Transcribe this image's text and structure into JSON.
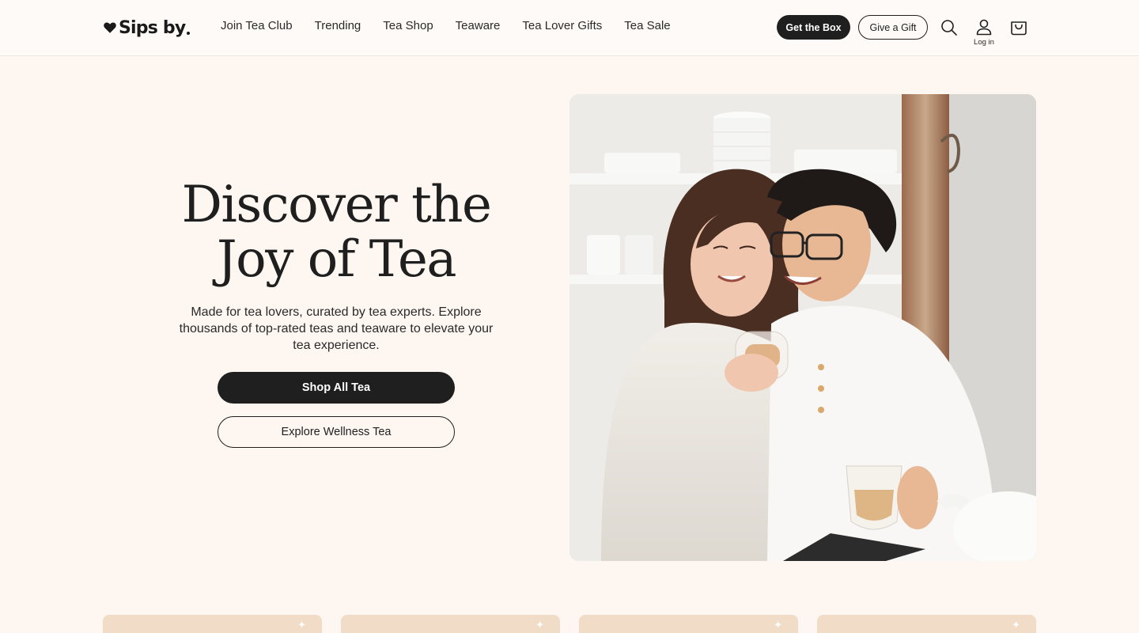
{
  "brand": {
    "name": "Sips by"
  },
  "nav": {
    "items": [
      {
        "label": "Join Tea Club"
      },
      {
        "label": "Trending"
      },
      {
        "label": "Tea Shop"
      },
      {
        "label": "Teaware"
      },
      {
        "label": "Tea Lover Gifts"
      },
      {
        "label": "Tea Sale"
      }
    ]
  },
  "header_actions": {
    "get_box_label": "Get the Box",
    "give_gift_label": "Give a Gift",
    "login_label": "Log in",
    "icons": [
      "search-icon",
      "account-icon",
      "cart-icon"
    ]
  },
  "hero": {
    "title_line1": "Discover the",
    "title_line2": "Joy of Tea",
    "subtitle": "Made for tea lovers, curated by tea experts. Explore thousands of top-rated teas and teaware to elevate your tea experience.",
    "primary_cta": "Shop All Tea",
    "secondary_cta": "Explore Wellness Tea",
    "image_alt": "couple-drinking-tea-photo"
  },
  "cards": [
    {
      "name": "category-card-1"
    },
    {
      "name": "category-card-2"
    },
    {
      "name": "category-card-3"
    },
    {
      "name": "category-card-4"
    }
  ],
  "colors": {
    "background": "#fdf6f1",
    "header_bg": "#fefaf7",
    "primary": "#1f1f1f",
    "card_bg": "#f0dcc7"
  }
}
